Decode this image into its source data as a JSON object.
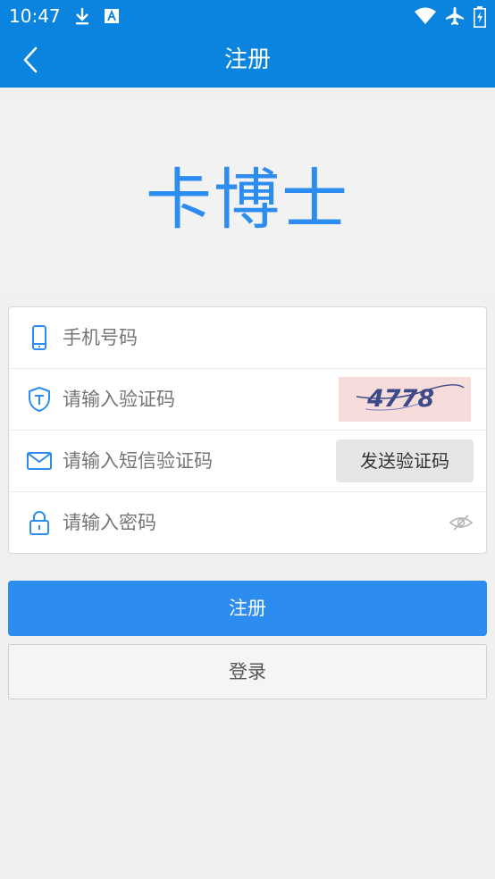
{
  "status_bar": {
    "time": "10:47",
    "left_icons": [
      "download-icon",
      "font-icon"
    ],
    "right_icons": [
      "wifi-icon",
      "airplane-icon",
      "battery-icon"
    ]
  },
  "app_bar": {
    "title": "注册",
    "back_icon": "chevron-left-icon"
  },
  "logo": {
    "text": "卡博士"
  },
  "form": {
    "phone": {
      "placeholder": "手机号码",
      "icon": "phone-icon"
    },
    "captcha": {
      "placeholder": "请输入验证码",
      "icon": "shield-icon",
      "image_text": "4778"
    },
    "sms": {
      "placeholder": "请输入短信验证码",
      "icon": "mail-icon",
      "button_label": "发送验证码"
    },
    "password": {
      "placeholder": "请输入密码",
      "icon": "lock-icon",
      "toggle_icon": "eye-hidden-icon"
    }
  },
  "buttons": {
    "register_label": "注册",
    "login_label": "登录"
  },
  "colors": {
    "primary": "#0a84df",
    "accent": "#2d8cf0"
  }
}
